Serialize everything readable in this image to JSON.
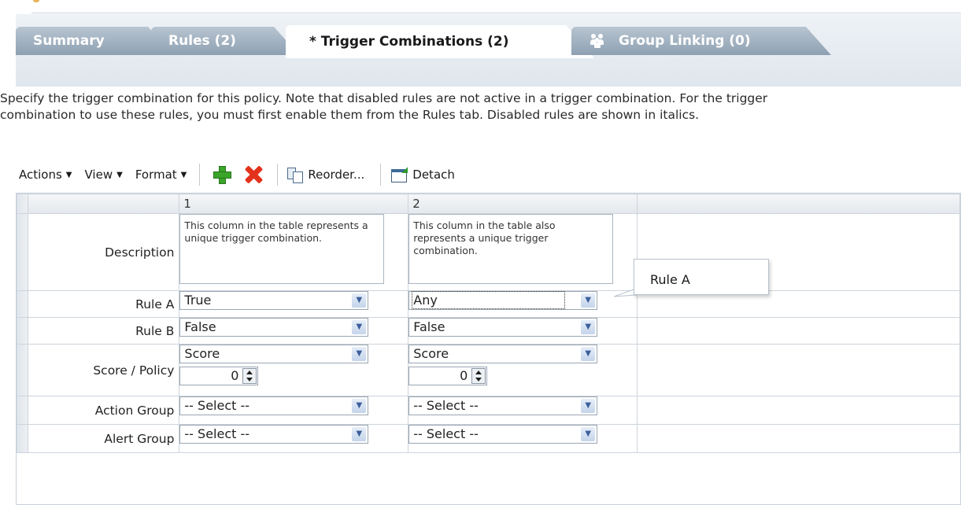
{
  "tabs": [
    {
      "label": "Summary"
    },
    {
      "label": "Rules (2)"
    },
    {
      "label": "* Trigger Combinations (2)"
    },
    {
      "label": "Group Linking (0)",
      "icon": "group-icon"
    }
  ],
  "active_tab": "* Trigger Combinations (2)",
  "instructions": {
    "line1": "Specify the trigger combination for this policy. Note that disabled rules are not active in a trigger combination. For the trigger",
    "line2": "combination to use these rules, you must first enable them from the Rules tab. Disabled rules are shown in italics."
  },
  "toolbar": {
    "actions": "Actions",
    "view": "View",
    "format": "Format",
    "add_icon": "add-icon",
    "delete_icon": "delete-icon",
    "reorder": "Reorder...",
    "detach": "Detach"
  },
  "table": {
    "columns": [
      "1",
      "2"
    ],
    "row_labels": {
      "description": "Description",
      "rule_a": "Rule A",
      "rule_b": "Rule B",
      "score_policy": "Score / Policy",
      "action_group": "Action Group",
      "alert_group": "Alert Group"
    },
    "col1": {
      "description": "This column in the table represents a unique trigger combination.",
      "rule_a": "True",
      "rule_b": "False",
      "score_policy": "Score",
      "score_value": "0",
      "action_group": "-- Select --",
      "alert_group": "-- Select --"
    },
    "col2": {
      "description": "This column in the table also represents a unique trigger combination.",
      "rule_a": "Any",
      "rule_b": "False",
      "score_policy": "Score",
      "score_value": "0",
      "action_group": "-- Select --",
      "alert_group": "-- Select --"
    }
  },
  "tooltip": "Rule A"
}
